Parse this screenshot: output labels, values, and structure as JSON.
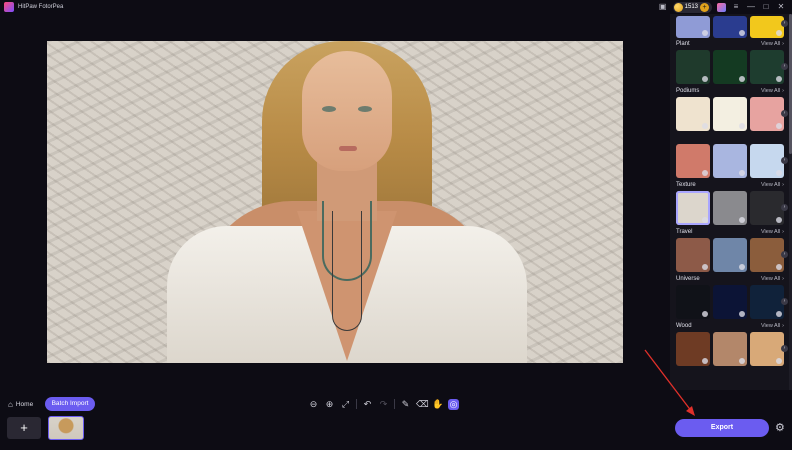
{
  "app": {
    "title": "HitPaw FotorPea"
  },
  "titlebar": {
    "credits": "1513",
    "icons": [
      "discord-icon",
      "coin-icon",
      "plus-icon",
      "badge-icon",
      "menu-icon",
      "minimize-icon",
      "maximize-icon",
      "close-icon"
    ],
    "menu_glyph": "≡",
    "minimize_glyph": "—",
    "maximize_glyph": "□",
    "close_glyph": "✕",
    "chat_glyph": "▣"
  },
  "panel": {
    "view_all_label": "View All",
    "view_all_chevron": "›",
    "row_arrow_glyph": "›",
    "categories": [
      {
        "label": "Plant",
        "colors": [
          "#1f3a2c",
          "#143a22",
          "#1e3d2f"
        ]
      },
      {
        "label": "Podiums",
        "colors": [
          "#efe3cf",
          "#f3efe1",
          "#e7a3a0"
        ]
      },
      {
        "label": "",
        "colors": [
          "#d07a6a",
          "#a9b6e0",
          "#c6d8ee"
        ]
      },
      {
        "label": "Texture",
        "colors": [
          "#dcd6cc",
          "#8a8a8e",
          "#2a2a2e"
        ]
      },
      {
        "label": "Travel",
        "colors": [
          "#8d5a48",
          "#6f86a8",
          "#8b5d3c"
        ]
      },
      {
        "label": "Universe",
        "colors": [
          "#101218",
          "#0c1436",
          "#10223a"
        ]
      },
      {
        "label": "Wood",
        "colors": [
          "#6e3b24",
          "#b3876a",
          "#d8a978"
        ]
      }
    ],
    "top_row_colors": [
      "#8f9bd6",
      "#2a3c8f",
      "#f2c81c"
    ]
  },
  "bottom": {
    "home_label": "Home",
    "home_glyph": "⌂",
    "batch_import_label": "Batch Import",
    "add_glyph": "+",
    "export_label": "Export",
    "settings_glyph": "⚙",
    "tools": {
      "zoom_out": "⊖",
      "zoom_in": "⊕",
      "fit": "⤢",
      "undo": "↶",
      "redo": "↷",
      "brush": "✎",
      "eraser": "⌫",
      "hand": "✋",
      "ai": "◎"
    }
  },
  "colors": {
    "accent": "#6b5cf0",
    "background": "#0d0c14",
    "panel": "#15141c",
    "annotation": "#e0302a"
  }
}
